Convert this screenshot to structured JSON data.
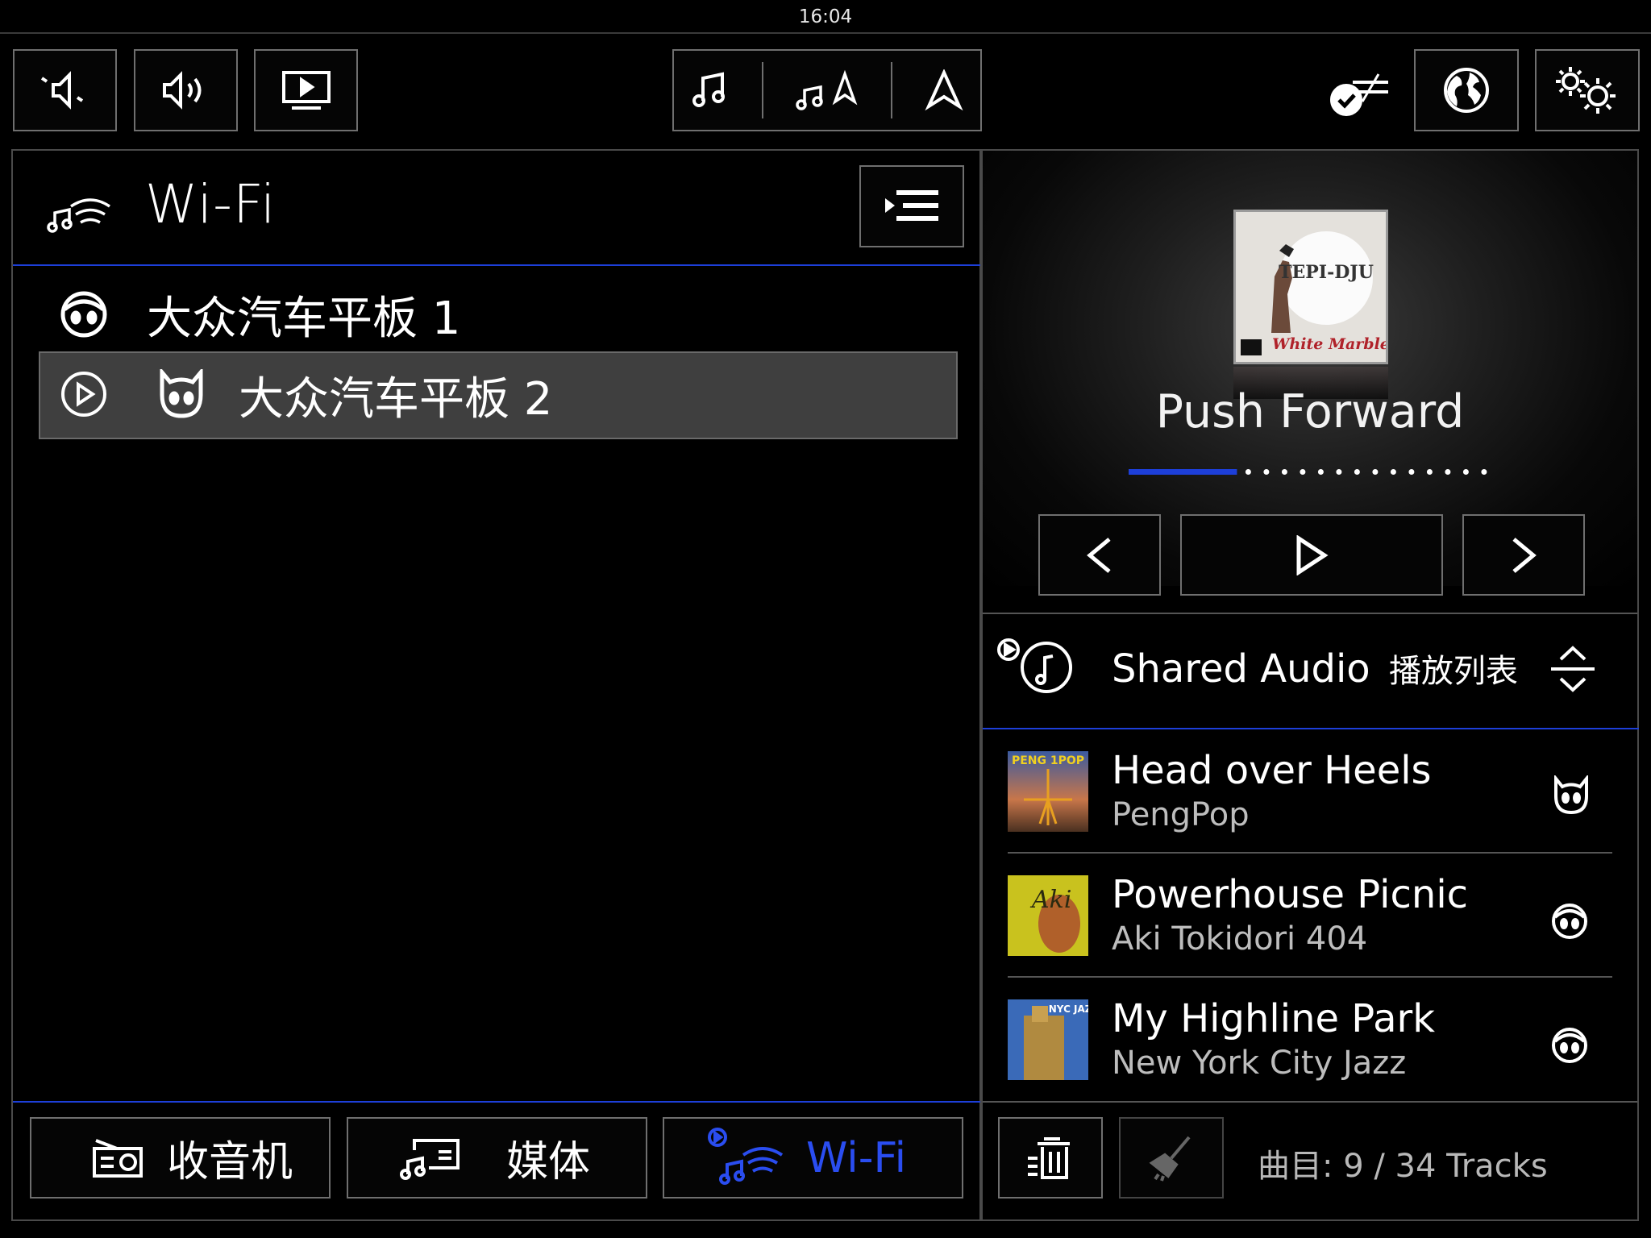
{
  "status_bar": {
    "time": "16:04"
  },
  "header": {
    "title": "Wi-Fi"
  },
  "devices": [
    {
      "label": "大众汽车平板 1"
    },
    {
      "label": "大众汽车平板 2"
    }
  ],
  "sources": [
    {
      "label": "收音机"
    },
    {
      "label": "媒体"
    },
    {
      "label": "Wi-Fi"
    }
  ],
  "player": {
    "now_playing": "Push Forward",
    "album_text": "TEPI-DJU",
    "album_subtitle": "White Marble",
    "progress": 0.3
  },
  "playlist": {
    "name": "Shared Audio",
    "suffix": "播放列表",
    "tracks": [
      {
        "title": "Head over Heels",
        "artist": "PengPop",
        "thumb_text": "PENG 1POP"
      },
      {
        "title": "Powerhouse Picnic",
        "artist": "Aki Tokidori 404",
        "thumb_text": "Aki"
      },
      {
        "title": "My Highline Park",
        "artist": "New York City Jazz",
        "thumb_text": "NYC JAZZ"
      }
    ],
    "count_label": "曲目: 9 / 34 Tracks"
  },
  "colors": {
    "accent": "#1d3fd9",
    "selected_row": "#3f3f3f",
    "border": "#6f6f6f"
  },
  "icons": [
    "mute-icon",
    "volume-icon",
    "screen-play-icon",
    "music-note-icon",
    "music-navigation-icon",
    "navigation-arrow-icon",
    "sync-check-icon",
    "globe-icon",
    "settings-gears-icon",
    "wifi-music-icon",
    "menu-list-icon",
    "face-icon",
    "play-circle-icon",
    "radio-icon",
    "media-icon",
    "delete-list-icon",
    "broom-icon",
    "previous-icon",
    "play-icon",
    "next-icon",
    "sort-icon"
  ]
}
